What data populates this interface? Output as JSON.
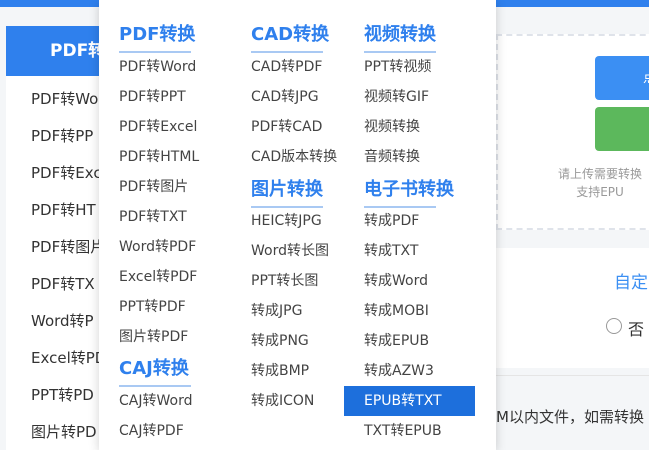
{
  "left_panel": {
    "header": "PDF转",
    "items": [
      "PDF转Wo",
      "PDF转PP",
      "PDF转Exc",
      "PDF转HT",
      "PDF转图片",
      "PDF转TX",
      "Word转P",
      "Excel转PD",
      "PPT转PD",
      "图片转PD"
    ]
  },
  "right": {
    "button1_label": "点",
    "hint_line1": "请上传需要转换",
    "hint_line2": "支持EPU",
    "custom_label": "自定",
    "radio_label": "否",
    "bottom_text": "M以内文件，如需转换"
  },
  "menu": {
    "pdf": {
      "title": "PDF转换",
      "items": [
        "PDF转Word",
        "PDF转PPT",
        "PDF转Excel",
        "PDF转HTML",
        "PDF转图片",
        "PDF转TXT",
        "Word转PDF",
        "Excel转PDF",
        "PPT转PDF",
        "图片转PDF"
      ]
    },
    "caj": {
      "title": "CAJ转换",
      "items": [
        "CAJ转Word",
        "CAJ转PDF"
      ]
    },
    "cad": {
      "title": "CAD转换",
      "items": [
        "CAD转PDF",
        "CAD转JPG",
        "PDF转CAD",
        "CAD版本转换"
      ]
    },
    "image": {
      "title": "图片转换",
      "items": [
        "HEIC转JPG",
        "Word转长图",
        "PPT转长图",
        "转成JPG",
        "转成PNG",
        "转成BMP",
        "转成ICON"
      ]
    },
    "video": {
      "title": "视频转换",
      "items": [
        "PPT转视频",
        "视频转GIF",
        "视频转换",
        "音频转换"
      ]
    },
    "ebook": {
      "title": "电子书转换",
      "items": [
        "转成PDF",
        "转成TXT",
        "转成Word",
        "转成MOBI",
        "转成EPUB",
        "转成AZW3",
        "EPUB转TXT",
        "TXT转EPUB"
      ]
    },
    "active_item": "EPUB转TXT"
  }
}
